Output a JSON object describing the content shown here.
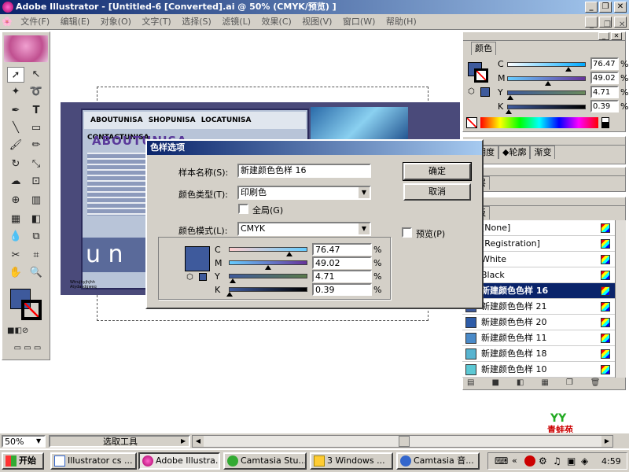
{
  "window": {
    "title": "Adobe Illustrator - [Untitled-6 [Converted].ai @ 50% (CMYK/预览) ]"
  },
  "menu": [
    "文件(F)",
    "编辑(E)",
    "对象(O)",
    "文字(T)",
    "选择(S)",
    "滤镜(L)",
    "效果(C)",
    "视图(V)",
    "窗口(W)",
    "帮助(H)"
  ],
  "artwork": {
    "nav": [
      "ABOUTUNISA",
      "SHOPUNISA",
      "LOCATUNISA",
      "CONTACTUNISA"
    ],
    "heading": "ABOUTUNISA",
    "u_text": "u n",
    "small_text": "Wtrujhyjhjhh\nAtydasdgweq"
  },
  "color_panel": {
    "tab": "颜色",
    "rows": [
      {
        "k": "C",
        "v": "76.47"
      },
      {
        "k": "M",
        "v": "49.02"
      },
      {
        "k": "Y",
        "v": "4.71"
      },
      {
        "k": "K",
        "v": "0.39"
      }
    ],
    "unit": "%"
  },
  "tabs2": {
    "a": "透明度",
    "b": "◆轮廓",
    "c": "渐变"
  },
  "tabs3": {
    "a": "图层"
  },
  "swatches": {
    "tab": "色板",
    "items": [
      {
        "name": "[None]",
        "color": "#ffffff"
      },
      {
        "name": "[Registration]",
        "color": "#000000"
      },
      {
        "name": "White",
        "color": "#ffffff"
      },
      {
        "name": "Black",
        "color": "#000000"
      },
      {
        "name": "新建颜色色样 16",
        "color": "#3e5a9c",
        "selected": true
      },
      {
        "name": "新建颜色色样 21",
        "color": "#3e5a9c"
      },
      {
        "name": "新建颜色色样 20",
        "color": "#2e5ca8"
      },
      {
        "name": "新建颜色色样 11",
        "color": "#4a8ac8"
      },
      {
        "name": "新建颜色色样 18",
        "color": "#58b4d0"
      },
      {
        "name": "新建颜色色样 10",
        "color": "#5cc8d4"
      }
    ]
  },
  "dialog": {
    "title": "色样选项",
    "name_label": "样本名称(S):",
    "name_value": "新建颜色色样 16",
    "type_label": "颜色类型(T):",
    "type_value": "印刷色",
    "global_label": "全局(G)",
    "mode_label": "颜色模式(L):",
    "mode_value": "CMYK",
    "ok": "确定",
    "cancel": "取消",
    "preview": "预览(P)",
    "rows": [
      {
        "k": "C",
        "v": "76.47"
      },
      {
        "k": "M",
        "v": "49.02"
      },
      {
        "k": "Y",
        "v": "4.71"
      },
      {
        "k": "K",
        "v": "0.39"
      }
    ],
    "unit": "%"
  },
  "status": {
    "zoom": "50%",
    "tool": "选取工具"
  },
  "taskbar": {
    "start": "开始",
    "tasks": [
      "Illustrator cs ...",
      "Adobe Illustra...",
      "Camtasia Stu...",
      "3 Windows ...",
      "Camtasia 音..."
    ],
    "time": "4:59"
  },
  "logo_text": "青蛙苑",
  "colors": {
    "swatch": "#3e5a9c",
    "title": "#0a246a"
  }
}
